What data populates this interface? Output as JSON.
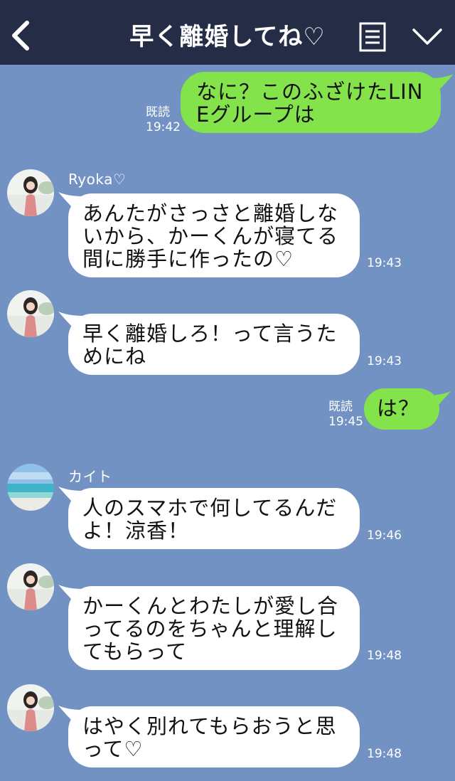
{
  "header": {
    "title": "早く離婚してね♡",
    "back_icon": "chevron-left-icon",
    "menu_icon": "menu-list-icon",
    "collapse_icon": "chevron-down-icon"
  },
  "colors": {
    "header_bg": "#252c45",
    "chat_bg": "#7392c4",
    "outgoing_bubble": "#84e34b",
    "incoming_bubble": "#ffffff"
  },
  "messages": [
    {
      "direction": "out",
      "text": "なに？このふざけたLIN\nEグループは",
      "read_label": "既読",
      "time": "19:42"
    },
    {
      "direction": "in",
      "sender": "Ryoka♡",
      "text": "あんたがさっさと離婚しな\nいから、かーくんが寝てる\n間に勝手に作ったの♡",
      "time": "19:43"
    },
    {
      "direction": "in",
      "sender": "",
      "text": "早く離婚しろ！って言うた\nめにね",
      "time": "19:43"
    },
    {
      "direction": "out",
      "text": "は？",
      "read_label": "既読",
      "time": "19:45"
    },
    {
      "direction": "in",
      "sender": "カイト",
      "text": "人のスマホで何してるんだ\nよ！涼香！",
      "time": "19:46"
    },
    {
      "direction": "in",
      "sender": "",
      "text": "かーくんとわたしが愛し合\nってるのをちゃんと理解し\nてもらって",
      "time": "19:48"
    },
    {
      "direction": "in",
      "sender": "",
      "text": "はやく別れてもらおうと思\nって♡",
      "time": "19:48"
    }
  ]
}
